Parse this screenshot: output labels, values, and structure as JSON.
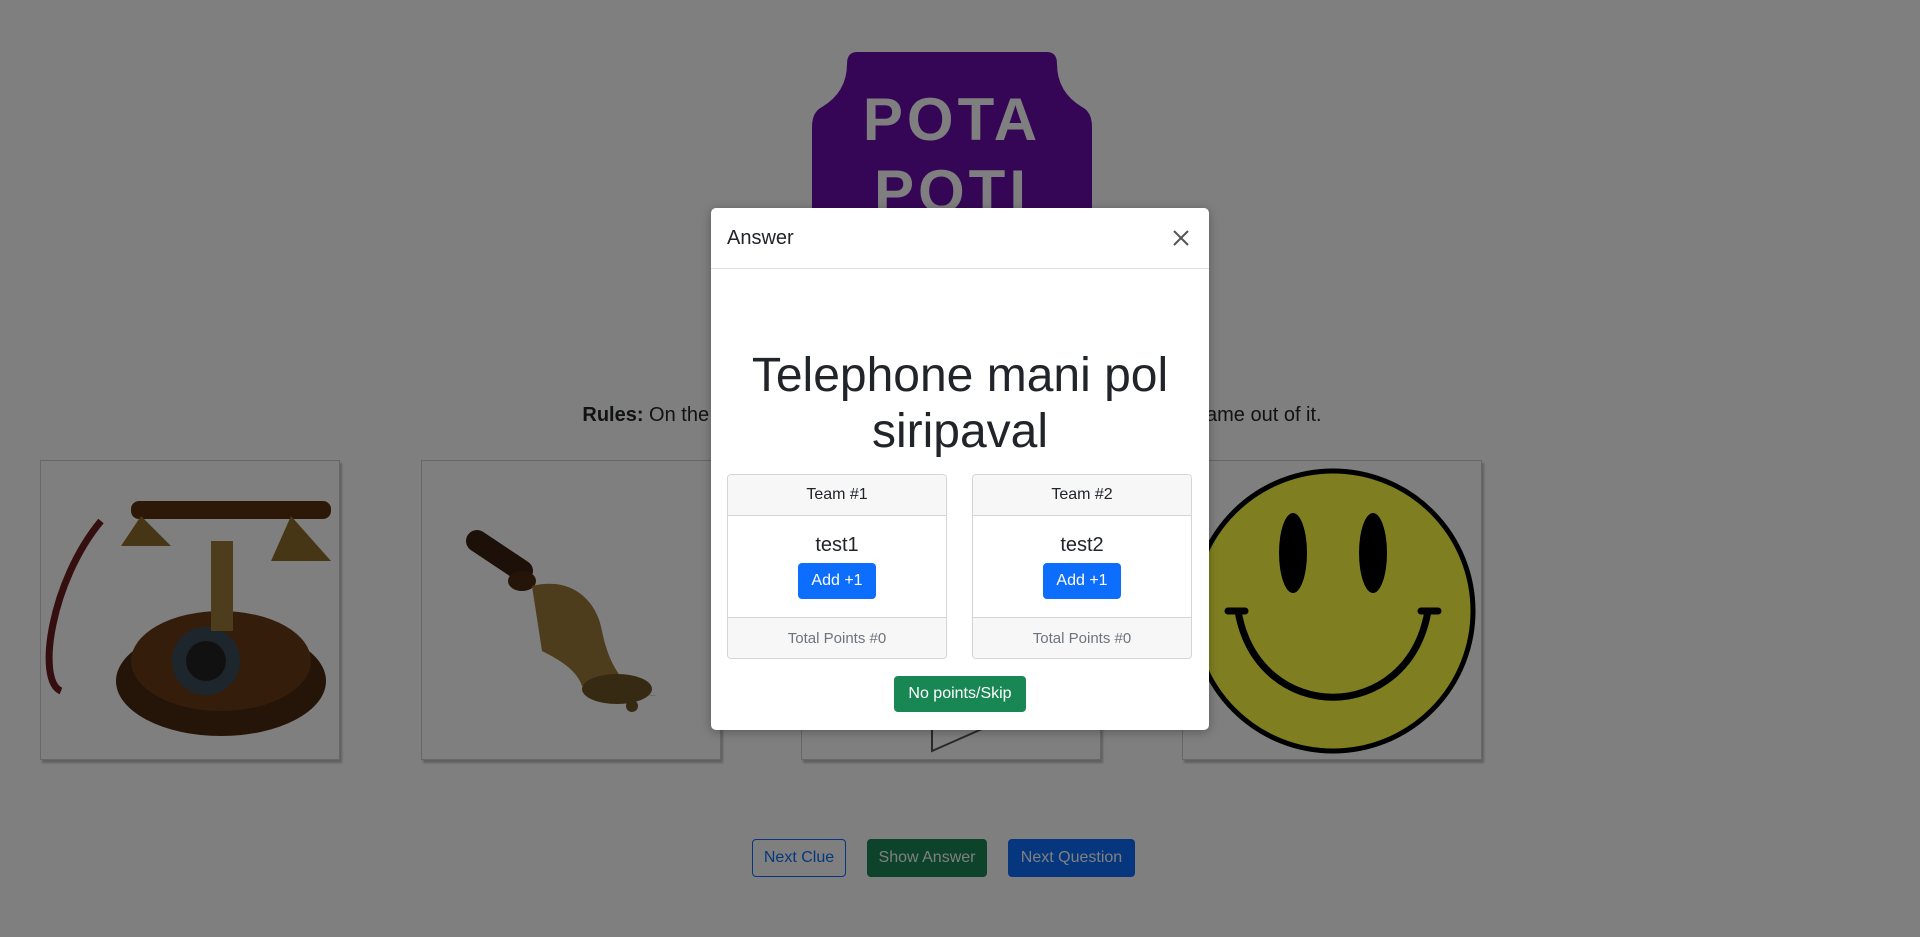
{
  "logo": {
    "line1": "POTA",
    "line2": "POTI",
    "color": "#6a0dad"
  },
  "rules": {
    "label": "Rules:",
    "text": " On the screen you will see some pictures, try to find the song name out of it."
  },
  "clues": [
    {
      "icon": "telephone-image"
    },
    {
      "icon": "bell-image"
    },
    {
      "icon": "paper-image"
    },
    {
      "icon": "smiley-face-image"
    }
  ],
  "controls": {
    "next_clue": "Next Clue",
    "show_answer": "Show Answer",
    "next_question": "Next Question"
  },
  "modal": {
    "title": "Answer",
    "answer": "Telephone mani pol siripaval",
    "teams": [
      {
        "header": "Team #1",
        "name": "test1",
        "add_label": "Add +1",
        "total": "Total Points #0"
      },
      {
        "header": "Team #2",
        "name": "test2",
        "add_label": "Add +1",
        "total": "Total Points #0"
      }
    ],
    "skip_label": "No points/Skip"
  },
  "colors": {
    "primary": "#0d6efd",
    "success": "#198754",
    "smiley": "#c8c83a"
  }
}
